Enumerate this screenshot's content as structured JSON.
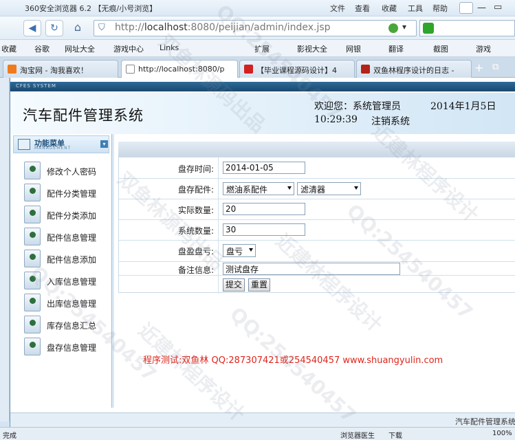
{
  "browser": {
    "title": "360安全浏览器 6.2 【无痕/小号浏览】",
    "menu": [
      "文件",
      "查看",
      "收藏",
      "工具",
      "帮助"
    ],
    "url_prefix": "http://",
    "url_host": "localhost",
    "url_rest": ":8080/peijian/admin/index.jsp",
    "favorites": [
      "收藏",
      "谷歌",
      "网址大全",
      "游戏中心",
      "Links",
      "扩展",
      "影视大全",
      "网银",
      "翻译",
      "截图",
      "游戏"
    ],
    "tabs": [
      {
        "label": "淘宝网 - 淘我喜欢！",
        "color": "#f07b1c",
        "active": false
      },
      {
        "label": "http://localhost:8080/p",
        "color": "#ffffff",
        "active": true
      },
      {
        "label": "【毕业课程源码设计】4",
        "color": "#d22020",
        "active": false
      },
      {
        "label": "双鱼林程序设计的日志 -",
        "color": "#b32318",
        "active": false
      }
    ],
    "status_left": "完成",
    "status_right": [
      "浏览器医生",
      "下载",
      "100%"
    ]
  },
  "app": {
    "system_label": "CFES SYSTEM",
    "title": "汽车配件管理系统",
    "welcome": "欢迎您：系统管理员",
    "date": "2014年1月5日",
    "time": "10:29:39",
    "logout": "注销系统",
    "footer": "汽车配件管理系统"
  },
  "sidebar": {
    "heading": "功能菜单",
    "heading_en": "MANAGEMENT",
    "items": [
      "修改个人密码",
      "配件分类管理",
      "配件分类添加",
      "配件信息管理",
      "配件信息添加",
      "入库信息管理",
      "出库信息管理",
      "库存信息汇总",
      "盘存信息管理"
    ]
  },
  "form": {
    "time_label": "盘存时间:",
    "time_value": "2014-01-05",
    "part_label": "盘存配件:",
    "category_value": "燃油系配件",
    "part_value": "滤清器",
    "actual_label": "实际数量:",
    "actual_value": "20",
    "system_label": "系统数量:",
    "system_value": "30",
    "profit_label": "盘盈盘亏:",
    "profit_value": "盘亏",
    "note_label": "备注信息:",
    "note_value": "测试盘存",
    "submit": "提交",
    "reset": "重置"
  },
  "credits": "程序测试:双鱼林 QQ:287307421或254540457 www.shuangyulin.com",
  "watermarks": [
    "双鱼林源码出品",
    "QQ:254540457",
    "近建林程序设计"
  ]
}
